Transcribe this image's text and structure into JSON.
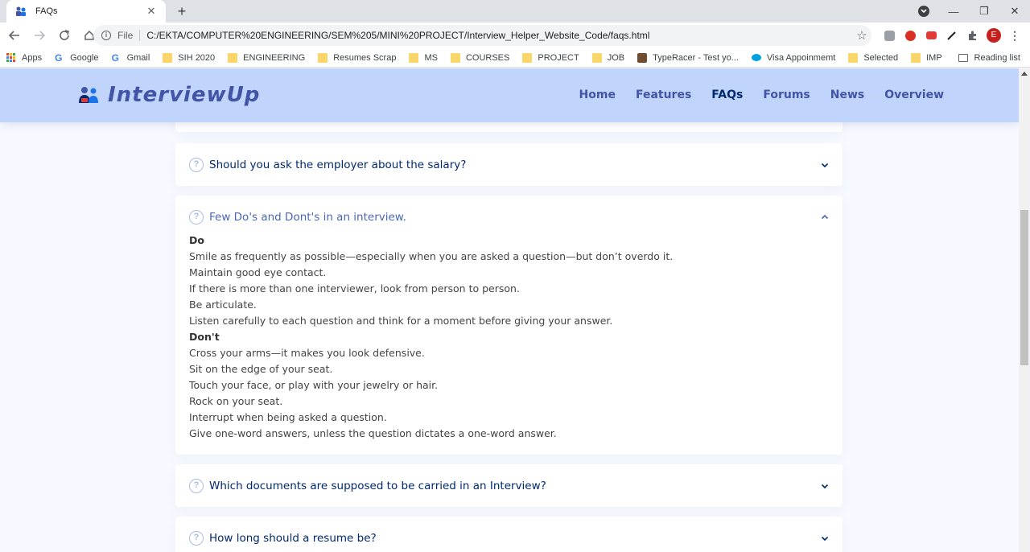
{
  "browser": {
    "tab_title": "FAQs",
    "url_scheme": "File",
    "url": "C:/EKTA/COMPUTER%20ENGINEERING/SEM%205/MINI%20PROJECT/Interview_Helper_Website_Code/faqs.html",
    "avatar_letter": "E",
    "bookmarks": [
      {
        "label": "Apps",
        "icon": "apps-grid-icon"
      },
      {
        "label": "Google",
        "icon": "google-icon"
      },
      {
        "label": "Gmail",
        "icon": "google-icon"
      },
      {
        "label": "SIH 2020",
        "icon": "folder-icon"
      },
      {
        "label": "ENGINEERING",
        "icon": "folder-icon"
      },
      {
        "label": "Resumes Scrap",
        "icon": "folder-icon"
      },
      {
        "label": "MS",
        "icon": "folder-icon"
      },
      {
        "label": "COURSES",
        "icon": "folder-icon"
      },
      {
        "label": "PROJECT",
        "icon": "folder-icon"
      },
      {
        "label": "JOB",
        "icon": "folder-icon"
      },
      {
        "label": "TypeRacer - Test yo...",
        "icon": "typeracer-icon"
      },
      {
        "label": "Visa Appoinmemt",
        "icon": "salesforce-icon"
      },
      {
        "label": "Selected",
        "icon": "folder-icon"
      },
      {
        "label": "IMP",
        "icon": "folder-icon"
      }
    ],
    "reading_list": "Reading list"
  },
  "site": {
    "logo_text": "InterviewUp",
    "nav": [
      {
        "label": "Home",
        "active": false
      },
      {
        "label": "Features",
        "active": false
      },
      {
        "label": "FAQs",
        "active": true
      },
      {
        "label": "Forums",
        "active": false
      },
      {
        "label": "News",
        "active": false
      },
      {
        "label": "Overview",
        "active": false
      }
    ]
  },
  "faqs": {
    "q_salary": "Should you ask the employer about the salary?",
    "q_dos": "Few Do's and Dont's in an interview.",
    "do_heading": "Do",
    "do_items": [
      "Smile as frequently as possible—especially when you are asked a question—but don’t overdo it.",
      "Maintain good eye contact.",
      "If there is more than one interviewer, look from person to person.",
      "Be articulate.",
      "Listen carefully to each question and think for a moment before giving your answer."
    ],
    "dont_heading": "Don't",
    "dont_items": [
      "Cross your arms—it makes you look defensive.",
      "Sit on the edge of your seat.",
      "Touch your face, or play with your jewelry or hair.",
      "Rock on your seat.",
      "Interrupt when being asked a question.",
      "Give one-word answers, unless the question dictates a one-word answer."
    ],
    "q_documents": "Which documents are supposed to be carried in an Interview?",
    "q_resume": "How long should a resume be?"
  },
  "colors": {
    "header_bg": "#c1d4fb",
    "brand": "#4154a6",
    "nav_active": "#012970",
    "question_icon": "#a7bde8",
    "open_question": "#4a67b7"
  }
}
